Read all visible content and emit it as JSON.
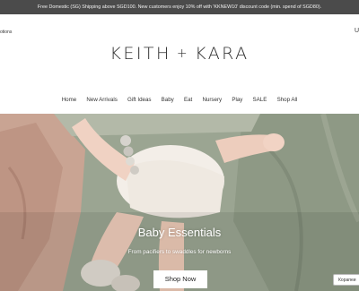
{
  "announcement": "Free Domestic (SG) Shipping above SGD100. New customers enjoy 10% off with 'KKNEW10' discount code (min. spend of SGD80).",
  "header": {
    "left_text": "otions",
    "right_text": "U",
    "logo_left": "KEITH",
    "logo_plus": "+",
    "logo_right": "KARA"
  },
  "nav": {
    "items": [
      "Home",
      "New Arrivals",
      "Gift Ideas",
      "Baby",
      "Eat",
      "Nursery",
      "Play",
      "SALE",
      "Shop All"
    ]
  },
  "hero": {
    "title": "Baby Essentials",
    "subtitle": "From pacifiers to swaddles for newborns",
    "cta": "Shop Now"
  },
  "language_badge": "Корапеи"
}
